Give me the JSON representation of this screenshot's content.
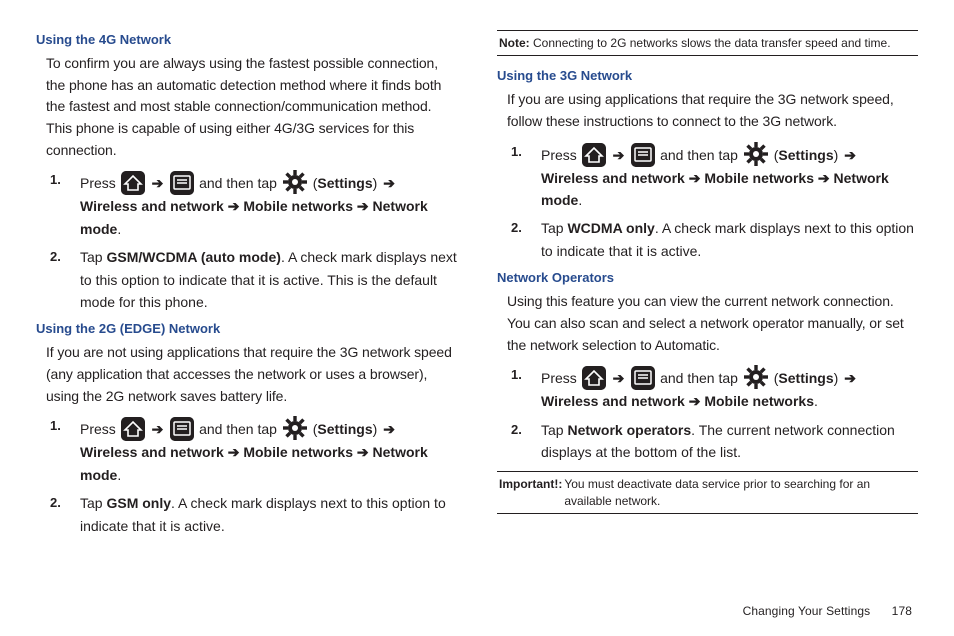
{
  "left": {
    "h4g": "Using the 4G Network",
    "p4g": "To confirm you are always using the fastest possible connection, the phone has an automatic detection method where it finds both the fastest and most stable connection/communication method. This phone is capable of using either 4G/3G services for this connection.",
    "s4g": {
      "s1_a": "Press ",
      "s1_b": " and then tap ",
      "s1_c": " (",
      "s1_settings": "Settings",
      "s1_d": ") ",
      "s1_chain": "Wireless and network ➔ Mobile networks  ➔ Network mode",
      "s1_e": ".",
      "s2_a": "Tap ",
      "s2_b": "GSM/WCDMA (auto mode)",
      "s2_c": ". A check mark displays next to this option to indicate that it is active. This is the default mode for this phone."
    },
    "h2g": "Using the 2G (EDGE) Network",
    "p2g": "If you are not using applications that require the 3G network speed (any application that accesses the network or uses a browser), using the 2G network saves battery life.",
    "s2g": {
      "s1_a": "Press ",
      "s1_b": " and then tap ",
      "s1_c": " (",
      "s1_settings": "Settings",
      "s1_d": ") ",
      "s1_chain": "Wireless and network ➔ Mobile networks  ➔ Network mode",
      "s1_e": ".",
      "s2_a": "Tap ",
      "s2_b": "GSM only",
      "s2_c": ". A check mark displays next to this option to indicate that it is active."
    }
  },
  "right": {
    "note_lbl": "Note:",
    "note_txt": " Connecting to 2G networks slows the data transfer speed and time.",
    "h3g": "Using the 3G Network",
    "p3g": "If you are using applications that require the 3G network speed, follow these instructions to connect to the 3G network.",
    "s3g": {
      "s1_a": "Press ",
      "s1_b": " and then tap ",
      "s1_c": " (",
      "s1_settings": "Settings",
      "s1_d": ") ",
      "s1_chain": "Wireless and network ➔ Mobile networks  ➔ Network mode",
      "s1_e": ".",
      "s2_a": "Tap ",
      "s2_b": "WCDMA only",
      "s2_c": ". A check mark displays next to this option to indicate that it is active."
    },
    "hnet": "Network Operators",
    "pnet": "Using this feature you can view the current network connection. You can also scan and select a network operator manually, or set the network selection to Automatic.",
    "snet": {
      "s1_a": "Press ",
      "s1_b": " and then tap ",
      "s1_c": " (",
      "s1_settings": "Settings",
      "s1_d": ") ",
      "s1_chain": "Wireless and network ➔ Mobile networks",
      "s1_e": ".",
      "s2_a": "Tap ",
      "s2_b": "Network operators",
      "s2_c": ". The current network connection displays at the bottom of the list."
    },
    "imp_lbl": "Important!:",
    "imp_txt": " You must deactivate data service prior to searching for an available network."
  },
  "footer": {
    "chapter": "Changing Your Settings",
    "page": "178"
  },
  "glyph": {
    "arrow": "➔"
  }
}
